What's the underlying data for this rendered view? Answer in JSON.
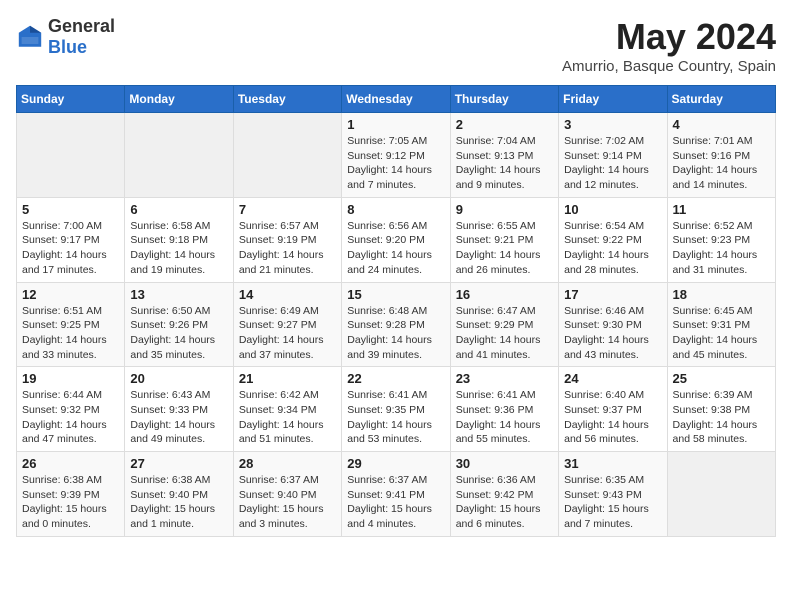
{
  "logo": {
    "general": "General",
    "blue": "Blue"
  },
  "title": {
    "month": "May 2024",
    "location": "Amurrio, Basque Country, Spain"
  },
  "weekdays": [
    "Sunday",
    "Monday",
    "Tuesday",
    "Wednesday",
    "Thursday",
    "Friday",
    "Saturday"
  ],
  "weeks": [
    [
      {
        "day": "",
        "info": ""
      },
      {
        "day": "",
        "info": ""
      },
      {
        "day": "",
        "info": ""
      },
      {
        "day": "1",
        "info": "Sunrise: 7:05 AM\nSunset: 9:12 PM\nDaylight: 14 hours\nand 7 minutes."
      },
      {
        "day": "2",
        "info": "Sunrise: 7:04 AM\nSunset: 9:13 PM\nDaylight: 14 hours\nand 9 minutes."
      },
      {
        "day": "3",
        "info": "Sunrise: 7:02 AM\nSunset: 9:14 PM\nDaylight: 14 hours\nand 12 minutes."
      },
      {
        "day": "4",
        "info": "Sunrise: 7:01 AM\nSunset: 9:16 PM\nDaylight: 14 hours\nand 14 minutes."
      }
    ],
    [
      {
        "day": "5",
        "info": "Sunrise: 7:00 AM\nSunset: 9:17 PM\nDaylight: 14 hours\nand 17 minutes."
      },
      {
        "day": "6",
        "info": "Sunrise: 6:58 AM\nSunset: 9:18 PM\nDaylight: 14 hours\nand 19 minutes."
      },
      {
        "day": "7",
        "info": "Sunrise: 6:57 AM\nSunset: 9:19 PM\nDaylight: 14 hours\nand 21 minutes."
      },
      {
        "day": "8",
        "info": "Sunrise: 6:56 AM\nSunset: 9:20 PM\nDaylight: 14 hours\nand 24 minutes."
      },
      {
        "day": "9",
        "info": "Sunrise: 6:55 AM\nSunset: 9:21 PM\nDaylight: 14 hours\nand 26 minutes."
      },
      {
        "day": "10",
        "info": "Sunrise: 6:54 AM\nSunset: 9:22 PM\nDaylight: 14 hours\nand 28 minutes."
      },
      {
        "day": "11",
        "info": "Sunrise: 6:52 AM\nSunset: 9:23 PM\nDaylight: 14 hours\nand 31 minutes."
      }
    ],
    [
      {
        "day": "12",
        "info": "Sunrise: 6:51 AM\nSunset: 9:25 PM\nDaylight: 14 hours\nand 33 minutes."
      },
      {
        "day": "13",
        "info": "Sunrise: 6:50 AM\nSunset: 9:26 PM\nDaylight: 14 hours\nand 35 minutes."
      },
      {
        "day": "14",
        "info": "Sunrise: 6:49 AM\nSunset: 9:27 PM\nDaylight: 14 hours\nand 37 minutes."
      },
      {
        "day": "15",
        "info": "Sunrise: 6:48 AM\nSunset: 9:28 PM\nDaylight: 14 hours\nand 39 minutes."
      },
      {
        "day": "16",
        "info": "Sunrise: 6:47 AM\nSunset: 9:29 PM\nDaylight: 14 hours\nand 41 minutes."
      },
      {
        "day": "17",
        "info": "Sunrise: 6:46 AM\nSunset: 9:30 PM\nDaylight: 14 hours\nand 43 minutes."
      },
      {
        "day": "18",
        "info": "Sunrise: 6:45 AM\nSunset: 9:31 PM\nDaylight: 14 hours\nand 45 minutes."
      }
    ],
    [
      {
        "day": "19",
        "info": "Sunrise: 6:44 AM\nSunset: 9:32 PM\nDaylight: 14 hours\nand 47 minutes."
      },
      {
        "day": "20",
        "info": "Sunrise: 6:43 AM\nSunset: 9:33 PM\nDaylight: 14 hours\nand 49 minutes."
      },
      {
        "day": "21",
        "info": "Sunrise: 6:42 AM\nSunset: 9:34 PM\nDaylight: 14 hours\nand 51 minutes."
      },
      {
        "day": "22",
        "info": "Sunrise: 6:41 AM\nSunset: 9:35 PM\nDaylight: 14 hours\nand 53 minutes."
      },
      {
        "day": "23",
        "info": "Sunrise: 6:41 AM\nSunset: 9:36 PM\nDaylight: 14 hours\nand 55 minutes."
      },
      {
        "day": "24",
        "info": "Sunrise: 6:40 AM\nSunset: 9:37 PM\nDaylight: 14 hours\nand 56 minutes."
      },
      {
        "day": "25",
        "info": "Sunrise: 6:39 AM\nSunset: 9:38 PM\nDaylight: 14 hours\nand 58 minutes."
      }
    ],
    [
      {
        "day": "26",
        "info": "Sunrise: 6:38 AM\nSunset: 9:39 PM\nDaylight: 15 hours\nand 0 minutes."
      },
      {
        "day": "27",
        "info": "Sunrise: 6:38 AM\nSunset: 9:40 PM\nDaylight: 15 hours\nand 1 minute."
      },
      {
        "day": "28",
        "info": "Sunrise: 6:37 AM\nSunset: 9:40 PM\nDaylight: 15 hours\nand 3 minutes."
      },
      {
        "day": "29",
        "info": "Sunrise: 6:37 AM\nSunset: 9:41 PM\nDaylight: 15 hours\nand 4 minutes."
      },
      {
        "day": "30",
        "info": "Sunrise: 6:36 AM\nSunset: 9:42 PM\nDaylight: 15 hours\nand 6 minutes."
      },
      {
        "day": "31",
        "info": "Sunrise: 6:35 AM\nSunset: 9:43 PM\nDaylight: 15 hours\nand 7 minutes."
      },
      {
        "day": "",
        "info": ""
      }
    ]
  ]
}
